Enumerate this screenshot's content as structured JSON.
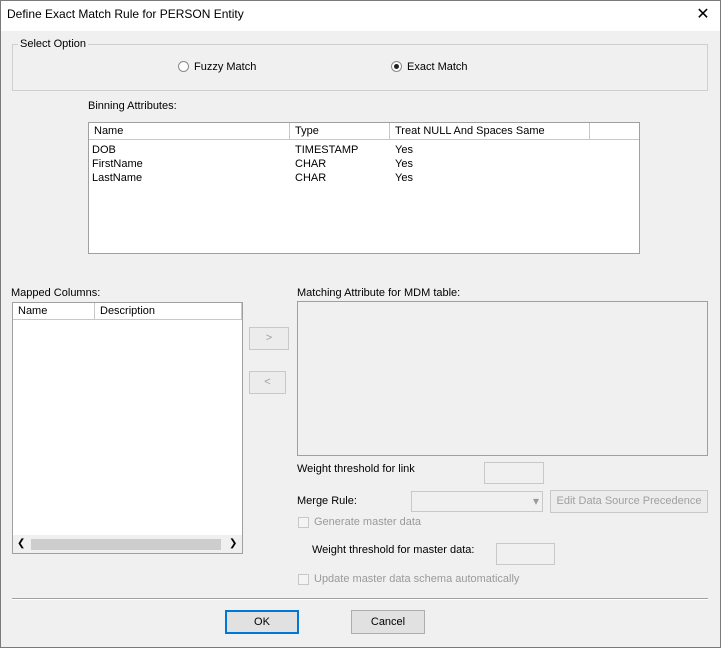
{
  "window": {
    "title": "Define Exact Match Rule for PERSON Entity",
    "close_glyph": "✕"
  },
  "select_option": {
    "legend": "Select Option",
    "fuzzy_label": "Fuzzy Match",
    "exact_label": "Exact Match",
    "selected": "Exact Match"
  },
  "binning": {
    "label": "Binning Attributes:",
    "columns": [
      "Name",
      "Type",
      "Treat NULL And Spaces Same"
    ],
    "rows": [
      {
        "name": "DOB",
        "type": "TIMESTAMP",
        "treat": "Yes"
      },
      {
        "name": "FirstName",
        "type": "CHAR",
        "treat": "Yes"
      },
      {
        "name": "LastName",
        "type": "CHAR",
        "treat": "Yes"
      }
    ]
  },
  "mapped": {
    "label": "Mapped Columns:",
    "columns": [
      "Name",
      "Description"
    ],
    "scroll_left": "❮",
    "scroll_right": "❯"
  },
  "transfer": {
    "add": ">",
    "remove": "<"
  },
  "matching": {
    "label": "Matching Attribute for MDM table:"
  },
  "settings": {
    "weight_link_label": "Weight threshold for link",
    "weight_link_value": "",
    "merge_rule_label": "Merge Rule:",
    "merge_rule_value": "",
    "dropdown_glyph": "▾",
    "edit_precedence_label": "Edit Data Source Precedence",
    "generate_master_label": "Generate master data",
    "weight_master_label": "Weight threshold for master data:",
    "weight_master_value": "",
    "update_schema_label": "Update master data schema automatically"
  },
  "footer": {
    "ok_label": "OK",
    "cancel_label": "Cancel"
  }
}
